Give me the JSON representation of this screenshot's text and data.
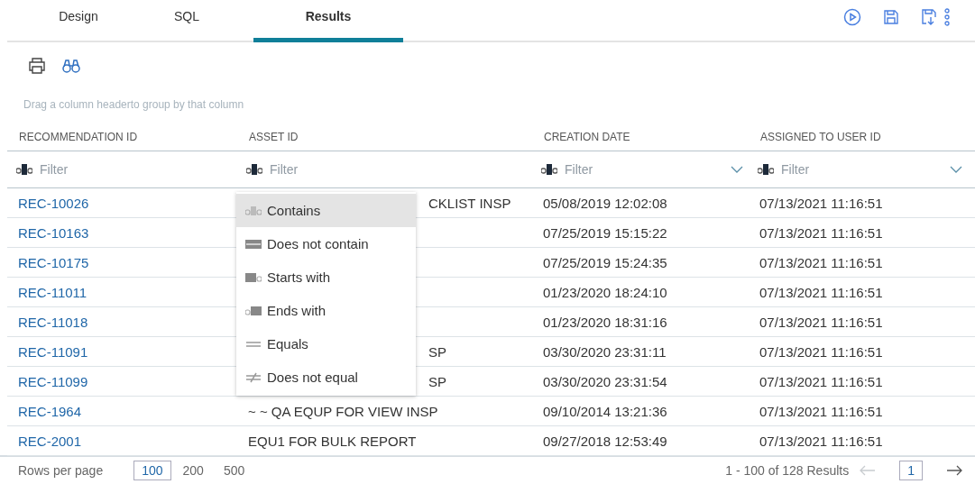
{
  "tabs": [
    {
      "label": "Design",
      "selected": false
    },
    {
      "label": "SQL",
      "selected": false
    },
    {
      "label": "Results",
      "selected": true
    }
  ],
  "group_hint": "Drag a column headerto group by that column",
  "table": {
    "columns": [
      {
        "label": "RECOMMENDATION ID",
        "filter_placeholder": "Filter",
        "has_dropdown": false
      },
      {
        "label": "ASSET ID",
        "filter_placeholder": "Filter",
        "has_dropdown": false
      },
      {
        "label": "CREATION DATE",
        "filter_placeholder": "Filter",
        "has_dropdown": true
      },
      {
        "label": "ASSIGNED TO USER ID",
        "filter_placeholder": "Filter",
        "has_dropdown": true
      }
    ],
    "rows": [
      {
        "recommendation_id": "REC-10026",
        "asset_id": "CKLIST INSP",
        "covered": true,
        "creation_date": "05/08/2019 12:02:08",
        "assigned_to_user_id": "07/13/2021 11:16:51"
      },
      {
        "recommendation_id": "REC-10163",
        "creation_date": "07/25/2019 15:15:22",
        "assigned_to_user_id": "07/13/2021 11:16:51"
      },
      {
        "recommendation_id": "REC-10175",
        "creation_date": "07/25/2019 15:24:35",
        "assigned_to_user_id": "07/13/2021 11:16:51"
      },
      {
        "recommendation_id": "REC-11011",
        "creation_date": "01/23/2020 18:24:10",
        "assigned_to_user_id": "07/13/2021 11:16:51"
      },
      {
        "recommendation_id": "REC-11018",
        "creation_date": "01/23/2020 18:31:16",
        "assigned_to_user_id": "07/13/2021 11:16:51"
      },
      {
        "recommendation_id": "REC-11091",
        "asset_id": "SP",
        "covered": true,
        "creation_date": "03/30/2020 23:31:11",
        "assigned_to_user_id": "07/13/2021 11:16:51"
      },
      {
        "recommendation_id": "REC-11099",
        "asset_id": "SP",
        "covered": true,
        "creation_date": "03/30/2020 23:31:54",
        "assigned_to_user_id": "07/13/2021 11:16:51"
      },
      {
        "recommendation_id": "REC-1964",
        "asset_id": "~ ~ QA EQUP FOR VIEW INSP",
        "covered": false,
        "creation_date": "09/10/2014 13:21:36",
        "assigned_to_user_id": "07/13/2021 11:16:51"
      },
      {
        "recommendation_id": "REC-2001",
        "asset_id": "EQU1 FOR BULK REPORT",
        "covered": false,
        "creation_date": "09/27/2018 12:53:49",
        "assigned_to_user_id": "07/13/2021 11:16:51"
      }
    ]
  },
  "filter_menu": [
    {
      "label": "Contains",
      "kind": "contains",
      "selected": true
    },
    {
      "label": "Does not contain",
      "kind": "not-contains",
      "selected": false
    },
    {
      "label": "Starts with",
      "kind": "starts",
      "selected": false
    },
    {
      "label": "Ends with",
      "kind": "ends",
      "selected": false
    },
    {
      "label": "Equals",
      "kind": "equals",
      "selected": false
    },
    {
      "label": "Does not equal",
      "kind": "not-equals",
      "selected": false
    }
  ],
  "footer": {
    "rows_per_page_label": "Rows per page",
    "page_sizes": [
      {
        "label": "100",
        "selected": true
      },
      {
        "label": "200",
        "selected": false
      },
      {
        "label": "500",
        "selected": false
      }
    ],
    "results": "1 - 100 of 128 Results",
    "current_page": "1"
  }
}
